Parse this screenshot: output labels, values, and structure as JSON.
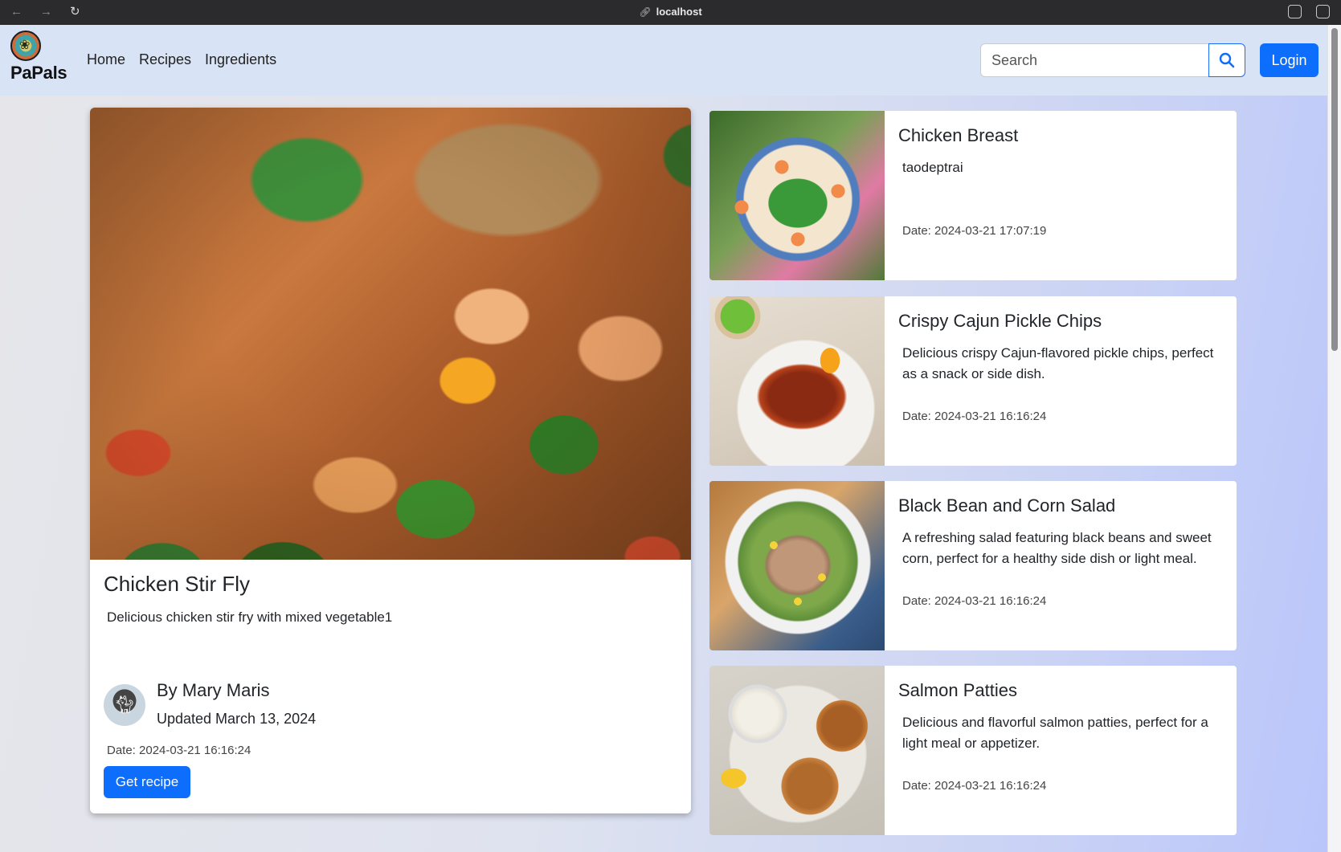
{
  "browser": {
    "url": "localhost"
  },
  "navbar": {
    "brand": "PaPals",
    "links": [
      "Home",
      "Recipes",
      "Ingredients"
    ],
    "search_placeholder": "Search",
    "login_label": "Login"
  },
  "featured": {
    "title": "Chicken Stir Fly",
    "description": "Delicious chicken stir fry with mixed vegetable1",
    "author": "By Mary Maris",
    "updated": "Updated March 13, 2024",
    "date": "Date: 2024-03-21 16:16:24",
    "button_label": "Get recipe"
  },
  "recipes": [
    {
      "title": "Chicken Breast",
      "description": "taodeptrai",
      "date": "Date: 2024-03-21 17:07:19"
    },
    {
      "title": "Crispy Cajun Pickle Chips",
      "description": "Delicious crispy Cajun-flavored pickle chips, perfect as a snack or side dish.",
      "date": "Date: 2024-03-21 16:16:24"
    },
    {
      "title": "Black Bean and Corn Salad",
      "description": "A refreshing salad featuring black beans and sweet corn, perfect for a healthy side dish or light meal.",
      "date": "Date: 2024-03-21 16:16:24"
    },
    {
      "title": "Salmon Patties",
      "description": "Delicious and flavorful salmon patties, perfect for a light meal or appetizer.",
      "date": "Date: 2024-03-21 16:16:24"
    }
  ],
  "colors": {
    "primary": "#0d6efd",
    "navbar_bg": "#d8e3f6"
  }
}
